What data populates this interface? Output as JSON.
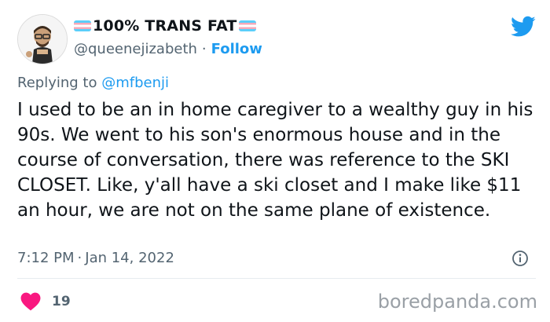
{
  "author": {
    "display_name": "100% TRANS FAT",
    "handle": "@queenejizabeth",
    "separator": "·",
    "follow_label": "Follow"
  },
  "reply": {
    "prefix": "Replying to",
    "mention": "@mfbenji"
  },
  "tweet": {
    "text": "I used to be an in home caregiver to a wealthy guy in his 90s. We went to his son's enormous house and in the course of conversation, there was reference to the SKI CLOSET. Like, y'all have a ski closet and I make like $11 an hour, we are not on the same plane of existence.",
    "time": "7:12 PM",
    "separator": "·",
    "date": "Jan 14, 2022"
  },
  "engagement": {
    "likes": "19"
  },
  "watermark": "boredpanda.com",
  "icons": {
    "platform": "twitter-bird-icon",
    "info": "info-icon",
    "like": "heart-icon",
    "flag": "trans-flag-icon"
  },
  "colors": {
    "accent": "#1d9bf0",
    "heart": "#f91880",
    "secondary_text": "#536471",
    "flag_blue": "#5bcefa",
    "flag_pink": "#f5a9b8"
  }
}
